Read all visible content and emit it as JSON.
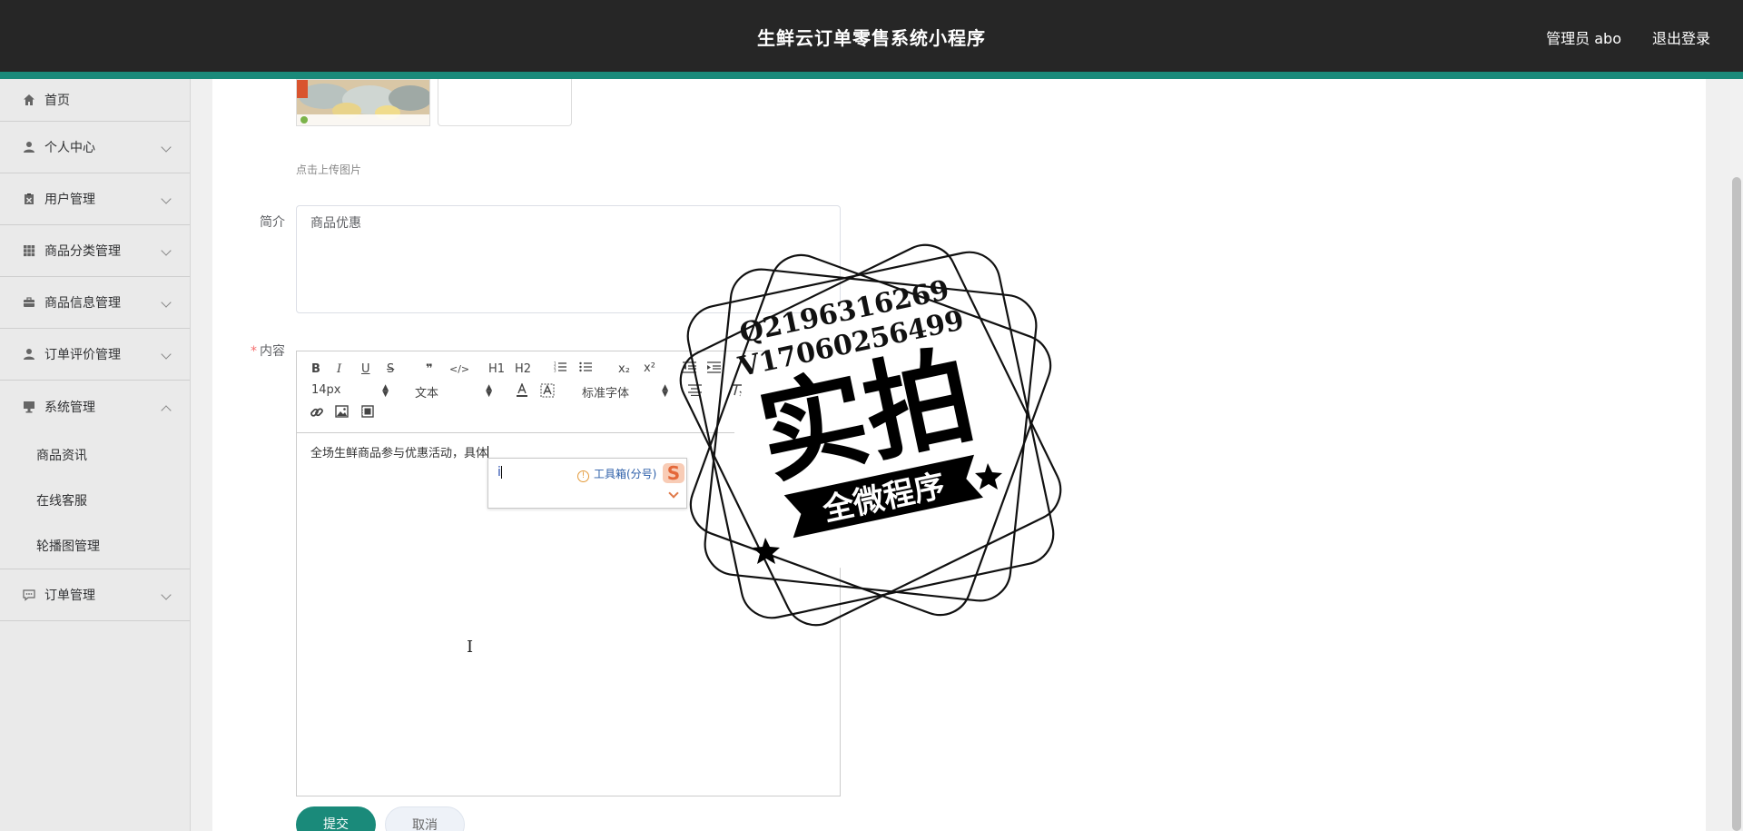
{
  "header": {
    "title": "生鲜云订单零售系统小程序",
    "user": "管理员 abo",
    "logout": "退出登录"
  },
  "sidebar": {
    "items": [
      {
        "label": "首页",
        "icon": "home-icon"
      },
      {
        "label": "个人中心",
        "icon": "user-icon"
      },
      {
        "label": "用户管理",
        "icon": "clipboard-icon"
      },
      {
        "label": "商品分类管理",
        "icon": "grid-icon"
      },
      {
        "label": "商品信息管理",
        "icon": "briefcase-icon"
      },
      {
        "label": "订单评价管理",
        "icon": "user-icon"
      },
      {
        "label": "系统管理",
        "icon": "monitor-icon"
      },
      {
        "label": "订单管理",
        "icon": "chat-icon"
      }
    ],
    "sub_items": [
      "商品资讯",
      "在线客服",
      "轮播图管理"
    ]
  },
  "form": {
    "upload_hint": "点击上传图片",
    "intro_label": "简介",
    "intro_value": "商品优惠",
    "content_label": "内容",
    "content_required_mark": "*",
    "content_text": "全场生鲜商品参与优惠活动，具体",
    "submit": "提交",
    "cancel": "取消"
  },
  "editor_toolbar": {
    "bold": "B",
    "italic": "I",
    "underline": "U",
    "strike": "S",
    "quote": "❞",
    "code": "</>",
    "h1": "H1",
    "h2": "H2",
    "subscript": "x₂",
    "superscript": "x²",
    "size": "14px",
    "format": "文本",
    "font": "标准字体"
  },
  "ime": {
    "input": "i",
    "hint": "工具箱(分号)"
  },
  "watermark": {
    "line1": "Q2196316269",
    "line2": "V17060256499",
    "big": "实拍",
    "ribbon": "全微程序"
  },
  "colors": {
    "header_bg": "#262626",
    "accent": "#1a8a7a",
    "sidebar_bg": "#eaeaea"
  }
}
